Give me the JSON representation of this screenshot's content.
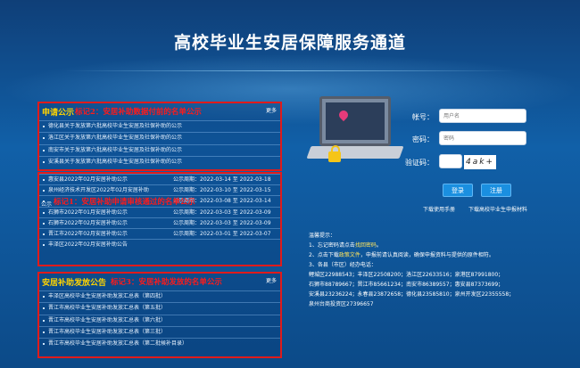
{
  "header": {
    "title": "高校毕业生安居保障服务通道"
  },
  "panel1": {
    "title": "申请公示",
    "note": "标记2：安居补助数据付前的名单公示",
    "more": "更多",
    "items": [
      "德化县关于发放第六批高校毕业生安居及社保补助的公示",
      "洛江区关于发放第六批高校毕业生安居及社保补助的公示",
      "南安市关于发放第六批高校毕业生安居及社保补助的公示",
      "安溪县关于发放第六批高校毕业生安居及社保补助的公示"
    ]
  },
  "panel2": {
    "overlay_note": "标记1：安居补助申请审核通过的名单公示",
    "gonggao": "公示",
    "items": [
      {
        "name": "惠安县2022年02月安居补助公示",
        "period": "公示周期：2022-03-14 至 2022-03-18"
      },
      {
        "name": "泉州经济技术开发区2022年02月安居补助",
        "period": "公示周期：2022-03-10 至 2022-03-15"
      },
      {
        "name": "",
        "period": "公示周期：2022-03-08 至 2022-03-14"
      },
      {
        "name": "石狮市2022年01月安居补助公示",
        "period": "公示周期：2022-03-03 至 2022-03-09"
      },
      {
        "name": "石狮市2022年02月安居补助公示",
        "period": "公示周期：2022-03-03 至 2022-03-09"
      },
      {
        "name": "晋江市2022年02月安居补助公示",
        "period": "公示周期：2022-03-01 至 2022-03-07"
      },
      {
        "name": "丰泽区2022年02月安居补助公告",
        "period": ""
      }
    ]
  },
  "panel3": {
    "title": "安居补助发放公告",
    "note": "标记3：安居补助发放的名单公示",
    "more": "更多",
    "items": [
      "丰泽区高校毕业生安居补助发放汇总表（第四批）",
      "晋江市高校毕业生安居补助发放汇总表（第五批）",
      "晋江市高校毕业生安居补助发放汇总表（第六批）",
      "晋江市高校毕业生安居补助发放汇总表（第三批）",
      "晋江市高校毕业生安居补助发放汇总表（第二批候补目录）"
    ]
  },
  "login": {
    "account_label": "帐号：",
    "account_placeholder": "用户名",
    "password_label": "密码：",
    "password_placeholder": "密码",
    "captcha_label": "验证码：",
    "captcha_text": "4ak+",
    "login_button": "登录",
    "register_button": "注册",
    "download_manual": "下载使用手册",
    "download_materials": "下载高校毕业生申报材料"
  },
  "tips": {
    "heading": "温馨提示：",
    "line1a": "1、忘记密码请点击",
    "line1b": "找回密码",
    "line1c": "。",
    "line2a": "2、点击下载",
    "line2b": "政策文件",
    "line2c": "，申报前请认真阅读，确保申报资料与提供的原件相符。",
    "line3": "3、各县（市区）经办电话：",
    "line4": "鲤城区22988543；丰泽区22508200；洛江区22633516；泉港区87991800；",
    "line5": "石狮市88789667；晋江市85661234；南安市86389557；惠安县87373699；",
    "line6": "安溪县23236224；永春县23872658；德化县23585810；泉州开发区22355558；",
    "line7": "泉州台商投资区27396657"
  }
}
